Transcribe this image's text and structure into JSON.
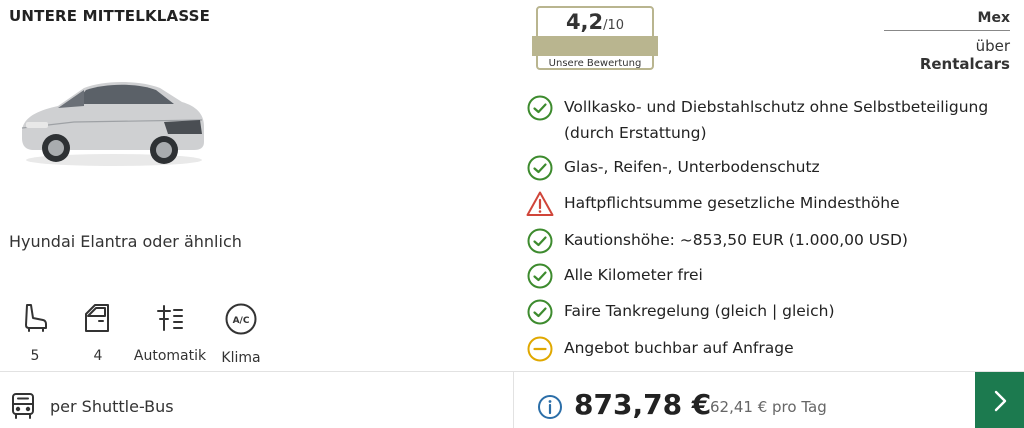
{
  "offer": {
    "category": "UNTERE MITTELKLASSE",
    "model": "Hyundai Elantra oder ähnlich",
    "car_image_icon": "sedan-car-image"
  },
  "specs": [
    {
      "icon": "seat-icon",
      "label": "5"
    },
    {
      "icon": "door-icon",
      "label": "4"
    },
    {
      "icon": "gearbox-icon",
      "label": "Automatik"
    },
    {
      "icon": "air-conditioning-icon",
      "label": "Klima"
    }
  ],
  "rating": {
    "score": "4,2",
    "out_of": "/10",
    "caption": "Unsere Bewertung",
    "color": "#b9b58f"
  },
  "provider": {
    "location": "Mex",
    "via_prefix": "über",
    "name": "Rentalcars"
  },
  "features": [
    {
      "status": "ok",
      "icon": "check-circle-icon",
      "line1": "Vollkasko- und Diebstahlschutz ohne Selbstbeteiligung",
      "line2": "(durch Erstattung)"
    },
    {
      "status": "ok",
      "icon": "check-circle-icon",
      "line1": "Glas-, Reifen-, Unterbodenschutz"
    },
    {
      "status": "warning",
      "icon": "warning-triangle-icon",
      "line1": "Haftpflichtsumme gesetzliche Mindesthöhe"
    },
    {
      "status": "ok",
      "icon": "check-circle-icon",
      "line1": "Kautionshöhe: ~853,50 EUR (1.000,00 USD)"
    },
    {
      "status": "ok",
      "icon": "check-circle-icon",
      "line1": "Alle Kilometer frei"
    },
    {
      "status": "ok",
      "icon": "check-circle-icon",
      "line1": "Faire Tankregelung (gleich | gleich)"
    },
    {
      "status": "neutral",
      "icon": "minus-circle-icon",
      "line1": "Angebot buchbar auf Anfrage"
    }
  ],
  "bottom": {
    "transfer_icon": "bus-icon",
    "transfer_label": "per Shuttle-Bus",
    "info_icon": "info-icon",
    "price": "873,78 €",
    "per_day": "62,41 € pro Tag",
    "cta_icon": "chevron-right-icon"
  },
  "colors": {
    "ok": "#3d8b2e",
    "warning": "#d0453a",
    "neutral": "#e0a800",
    "cta": "#1c7a4f",
    "info": "#2b6ea8"
  }
}
